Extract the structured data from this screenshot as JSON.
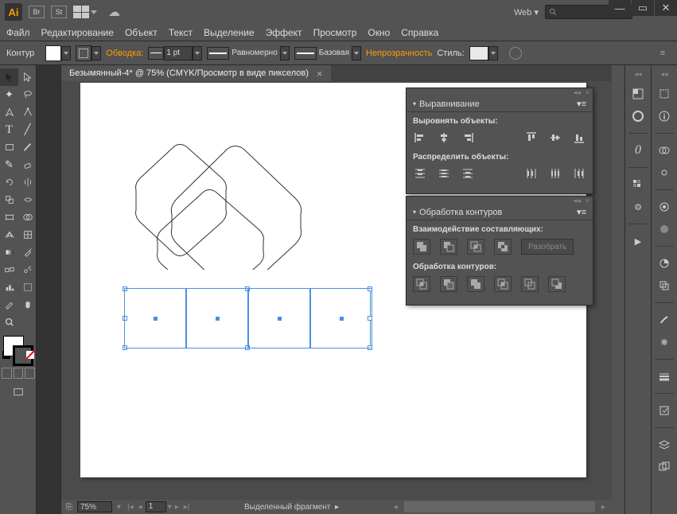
{
  "titlebar": {
    "app_logo": "Ai",
    "br_icon": "Br",
    "st_icon": "St",
    "workspace": "Web"
  },
  "menu": {
    "file": "Файл",
    "edit": "Редактирование",
    "object": "Объект",
    "text": "Текст",
    "select": "Выделение",
    "effect": "Эффект",
    "view": "Просмотр",
    "window": "Окно",
    "help": "Справка"
  },
  "controlbar": {
    "label": "Контур",
    "stroke_label": "Обводка:",
    "stroke_weight": "1 pt",
    "profile": "Равномерно",
    "brush": "Базовая",
    "opacity_label": "Непрозрачность",
    "style_label": "Стиль:"
  },
  "doctab": {
    "title": "Безымянный-4* @ 75% (CMYK/Просмотр в виде пикселов)"
  },
  "status": {
    "zoom": "75%",
    "page": "1",
    "selection": "Выделенный фрагмент"
  },
  "panels": {
    "align": {
      "title": "Выравнивание",
      "section1": "Выровнять объекты:",
      "section2": "Распределить объекты:"
    },
    "pathfinder": {
      "title": "Обработка контуров",
      "section1": "Взаимодействие составляющих:",
      "section2": "Обработка контуров:",
      "expand": "Разобрать"
    }
  }
}
